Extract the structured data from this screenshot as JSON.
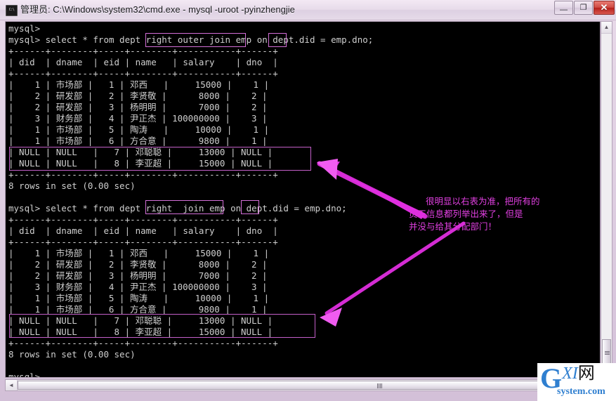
{
  "window": {
    "title": "管理员: C:\\Windows\\system32\\cmd.exe - mysql  -uroot -pyinzhengjie",
    "icon_label": "C:\\",
    "minimize_label": "—",
    "maximize_label": "❐",
    "close_label": "✕"
  },
  "scrollbars": {
    "vertical_up_label": "▲",
    "horizontal_left_label": "◄"
  },
  "terminal": {
    "lines": [
      "mysql>",
      "mysql> select * from dept right outer join emp on dept.did = emp.dno;",
      "+------+--------+-----+--------+-----------+------+",
      "| did  | dname  | eid | name   | salary    | dno  |",
      "+------+--------+-----+--------+-----------+------+",
      "|    1 | 市场部 |   1 | 邓西   |     15000 |    1 |",
      "|    2 | 研发部 |   2 | 李贤敬 |      8000 |    2 |",
      "|    2 | 研发部 |   3 | 杨明明 |      7000 |    2 |",
      "|    3 | 财务部 |   4 | 尹正杰 | 100000000 |    3 |",
      "|    1 | 市场部 |   5 | 陶涛   |     10000 |    1 |",
      "|    1 | 市场部 |   6 | 方合意 |      9800 |    1 |",
      "| NULL | NULL   |   7 | 邓聪聪 |     13000 | NULL |",
      "| NULL | NULL   |   8 | 李亚超 |     15000 | NULL |",
      "+------+--------+-----+--------+-----------+------+",
      "8 rows in set (0.00 sec)",
      "",
      "mysql> select * from dept right  join emp on dept.did = emp.dno;",
      "+------+--------+-----+--------+-----------+------+",
      "| did  | dname  | eid | name   | salary    | dno  |",
      "+------+--------+-----+--------+-----------+------+",
      "|    1 | 市场部 |   1 | 邓西   |     15000 |    1 |",
      "|    2 | 研发部 |   2 | 李贤敬 |      8000 |    2 |",
      "|    2 | 研发部 |   3 | 杨明明 |      7000 |    2 |",
      "|    3 | 财务部 |   4 | 尹正杰 | 100000000 |    3 |",
      "|    1 | 市场部 |   5 | 陶涛   |     10000 |    1 |",
      "|    1 | 市场部 |   6 | 方合意 |      9800 |    1 |",
      "| NULL | NULL   |   7 | 邓聪聪 |     13000 | NULL |",
      "| NULL | NULL   |   8 | 李亚超 |     15000 | NULL |",
      "+------+--------+-----+--------+-----------+------+",
      "8 rows in set (0.00 sec)",
      "",
      "mysql>"
    ],
    "prompt": "mysql>",
    "query_1": "select * from dept right outer join emp on dept.did = emp.dno;",
    "query_2": "select * from dept right  join emp on dept.did = emp.dno;",
    "result_footer": "8 rows in set (0.00 sec)",
    "columns": [
      "did",
      "dname",
      "eid",
      "name",
      "salary",
      "dno"
    ],
    "rows": [
      [
        "1",
        "市场部",
        "1",
        "邓西",
        "15000",
        "1"
      ],
      [
        "2",
        "研发部",
        "2",
        "李贤敬",
        "8000",
        "2"
      ],
      [
        "2",
        "研发部",
        "3",
        "杨明明",
        "7000",
        "2"
      ],
      [
        "3",
        "财务部",
        "4",
        "尹正杰",
        "100000000",
        "3"
      ],
      [
        "1",
        "市场部",
        "5",
        "陶涛",
        "10000",
        "1"
      ],
      [
        "1",
        "市场部",
        "6",
        "方合意",
        "9800",
        "1"
      ],
      [
        "NULL",
        "NULL",
        "7",
        "邓聪聪",
        "13000",
        "NULL"
      ],
      [
        "NULL",
        "NULL",
        "8",
        "李亚超",
        "15000",
        "NULL"
      ]
    ]
  },
  "annotations": {
    "highlight_keywords": [
      "right outer join",
      "on",
      "right  join",
      "on"
    ],
    "note_lines": [
      "很明显以右表为准，把所有的",
      "员工信息都列举出来了，但是",
      "并没与给其分配部门！"
    ],
    "accent_color": "#e13fe1",
    "box_color": "#d46fd8"
  },
  "watermark": {
    "g": "G",
    "xi": "XI",
    "net": "网",
    "sub": "system.com"
  }
}
